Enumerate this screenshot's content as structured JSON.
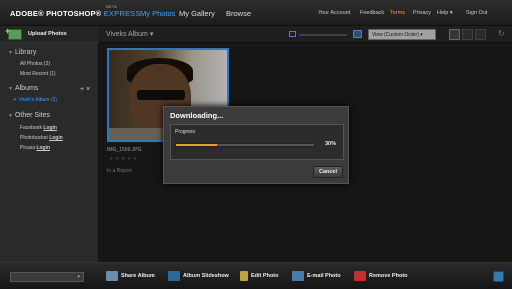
{
  "header": {
    "logo": "ADOBE® PHOTOSHOP®",
    "logo_express": "EXPRESS",
    "logo_beta": "BETA",
    "tabs": [
      "My Photos",
      "My Gallery",
      "Browse"
    ],
    "links": [
      "Your Account",
      "Feedback",
      "Terms",
      "Privacy",
      "Help ▾",
      "Sign Out"
    ]
  },
  "sidebar": {
    "upload_label": "Upload Photos",
    "library_title": "Library",
    "library_items": [
      "All Photos (2)",
      "Most Recent (1)"
    ],
    "albums_title": "Albums",
    "album_selected": "Vivek's Album (2)",
    "other_sites_title": "Other Sites",
    "sites": [
      {
        "name": "Facebook",
        "action": "Login"
      },
      {
        "name": "Photobucket",
        "action": "Login"
      },
      {
        "name": "Picasa",
        "action": "Login"
      }
    ]
  },
  "main": {
    "album_title": "Viveks Album ▾",
    "order_label": "View (Custom Order)",
    "photo_caption": "IMG_1599.JPG",
    "stars": "★★★★★",
    "report_label": "In a Report"
  },
  "dialog": {
    "title": "Downloading...",
    "progress_label": "Progress",
    "progress_value": 0.3,
    "progress_text": "30%",
    "cancel_label": "Cancel"
  },
  "bottom": {
    "actions": [
      "Share Album",
      "Album Slideshow",
      "Edit Photo",
      "E-mail Photo",
      "Remove Photo"
    ]
  }
}
